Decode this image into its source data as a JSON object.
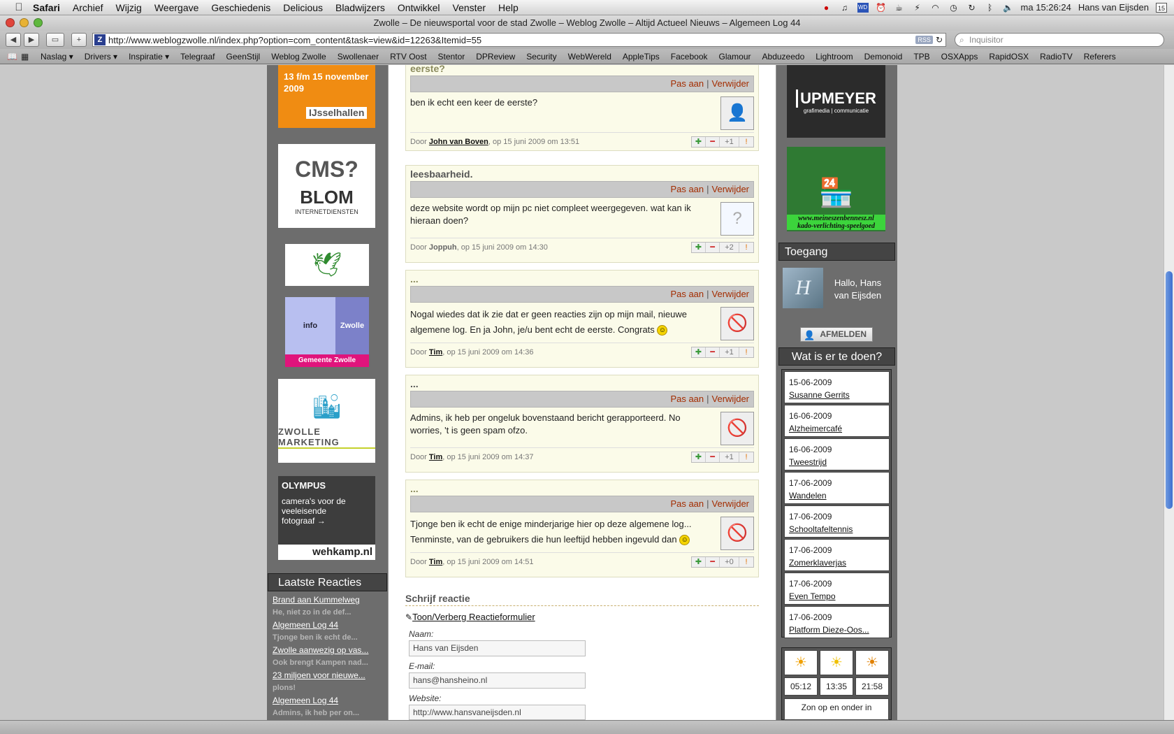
{
  "menubar": {
    "apple": "",
    "app": "Safari",
    "menus": [
      "Archief",
      "Wijzig",
      "Weergave",
      "Geschiedenis",
      "Delicious",
      "Bladwijzers",
      "Ontwikkel",
      "Venster",
      "Help"
    ],
    "clock": "ma 15:26:24",
    "user": "Hans van Eijsden",
    "calendar_day": "15"
  },
  "window": {
    "title": "Zwolle – De nieuwsportal voor de stad Zwolle – Weblog Zwolle – Altijd Actueel Nieuws – Algemeen Log 44"
  },
  "toolbar": {
    "url": "http://www.weblogzwolle.nl/index.php?option=com_content&task=view&id=12263&Itemid=55",
    "favicon": "Z",
    "rss": "RSS",
    "search_placeholder": "Inquisitor"
  },
  "bookmarks": [
    "Naslag ▾",
    "Drivers ▾",
    "Inspiratie ▾",
    "Telegraaf",
    "GeenStijl",
    "Weblog Zwolle",
    "Swollenaer",
    "RTV Oost",
    "Stentor",
    "DPReview",
    "Security",
    "WebWereld",
    "AppleTips",
    "Facebook",
    "Glamour",
    "Abduzeedo",
    "Lightroom",
    "Demonoid",
    "TPB",
    "OSXApps",
    "RapidOSX",
    "RadioTV",
    "Referers"
  ],
  "left": {
    "ad_ijssel": {
      "date": "13 f/m 15 november 2009",
      "name": "IJsselhallen"
    },
    "ad_blom": {
      "line1": "CMS?",
      "line2": "BLOM",
      "line3": "INTERNETDIENSTEN"
    },
    "ad_info": {
      "left": "info",
      "right": "Zwolle",
      "bottom": "Gemeente Zwolle"
    },
    "ad_marketing": "ZWOLLE MARKETING",
    "ad_olympus": {
      "brand": "OLYMPUS",
      "text": "camera's voor de veeleisende fotograaf →",
      "site": "wehkamp.nl"
    },
    "latest_title": "Laatste Reacties",
    "latest": [
      {
        "link": "Brand aan Kummelweg",
        "sub": "He, niet zo in de def..."
      },
      {
        "link": "Algemeen Log 44",
        "sub": "Tjonge ben ik echt de..."
      },
      {
        "link": "Zwolle aanwezig op vas...",
        "sub": "Ook brengt Kampen nad..."
      },
      {
        "link": "23 miljoen voor nieuwe...",
        "sub": "plons!"
      },
      {
        "link": "Algemeen Log 44",
        "sub": "Admins, ik heb per on..."
      }
    ]
  },
  "comments": [
    {
      "title": "eerste?",
      "edit": "Pas aan",
      "delete": "Verwijder",
      "text": "ben ik echt een keer de eerste?",
      "by": "Door",
      "author": "John van Boven",
      "date": ", op 15 juni 2009 om 13:51",
      "score": "+1",
      "avatar": "👤"
    },
    {
      "title": "leesbaarheid.",
      "edit": "Pas aan",
      "delete": "Verwijder",
      "text": "deze website wordt op mijn pc niet compleet weergegeven. wat kan ik hieraan doen?",
      "by": "Door",
      "author": "Joppuh",
      "date": ", op 15 juni 2009 om 14:30",
      "score": "+2",
      "avatar": "?"
    },
    {
      "title": "...",
      "edit": "Pas aan",
      "delete": "Verwijder",
      "text": "Nogal wiedes dat ik zie dat er geen reacties zijn op mijn mail, nieuwe algemene log. En ja John, je/u bent echt de eerste. Congrats",
      "by": "Door",
      "author": "Tim",
      "date": ", op 15 juni 2009 om 14:36",
      "score": "+1",
      "avatar": "🚫"
    },
    {
      "title": "...",
      "edit": "Pas aan",
      "delete": "Verwijder",
      "text": "Admins, ik heb per ongeluk bovenstaand bericht gerapporteerd. No worries, 't is geen spam ofzo.",
      "by": "Door",
      "author": "Tim",
      "date": ", op 15 juni 2009 om 14:37",
      "score": "+1",
      "avatar": "🚫"
    },
    {
      "title": "...",
      "edit": "Pas aan",
      "delete": "Verwijder",
      "text": "Tjonge ben ik echt de enige minderjarige hier op deze algemene log... Tenminste, van de gebruikers die hun leeftijd hebben ingevuld dan",
      "by": "Door",
      "author": "Tim",
      "date": ", op 15 juni 2009 om 14:51",
      "score": "+0",
      "avatar": "🚫"
    }
  ],
  "form": {
    "title": "Schrijf reactie",
    "toggle": "Toon/Verberg Reactieformulier",
    "name_label": "Naam:",
    "name_value": "Hans van Eijsden",
    "email_label": "E-mail:",
    "email_value": "hans@hansheino.nl",
    "website_label": "Website:",
    "website_value": "http://www.hansvaneijsden.nl"
  },
  "right": {
    "ad_upmeyer": {
      "name": "UPMEYER",
      "sub": "grafimedia | communicatie"
    },
    "ad_shop": {
      "url": "www.meineszenbennesz.nl",
      "sub": "kado-verlichting-speelgoed"
    },
    "access_title": "Toegang",
    "greeting": "Hallo, Hans van Eijsden",
    "logout": "AFMELDEN",
    "events_title": "Wat is er te doen?",
    "events": [
      {
        "date": "15-06-2009",
        "name": "Susanne Gerrits"
      },
      {
        "date": "16-06-2009",
        "name": "Alzheimercafé"
      },
      {
        "date": "16-06-2009",
        "name": "Tweestrijd"
      },
      {
        "date": "17-06-2009",
        "name": "Wandelen"
      },
      {
        "date": "17-06-2009",
        "name": "Schooltafeltennis"
      },
      {
        "date": "17-06-2009",
        "name": "Zomerklaverjas"
      },
      {
        "date": "17-06-2009",
        "name": "Even Tempo"
      },
      {
        "date": "17-06-2009",
        "name": "Platform Dieze-Oos..."
      }
    ],
    "sun_times": [
      "05:12",
      "13:35",
      "21:58"
    ],
    "sun_caption": "Zon op en onder in"
  }
}
